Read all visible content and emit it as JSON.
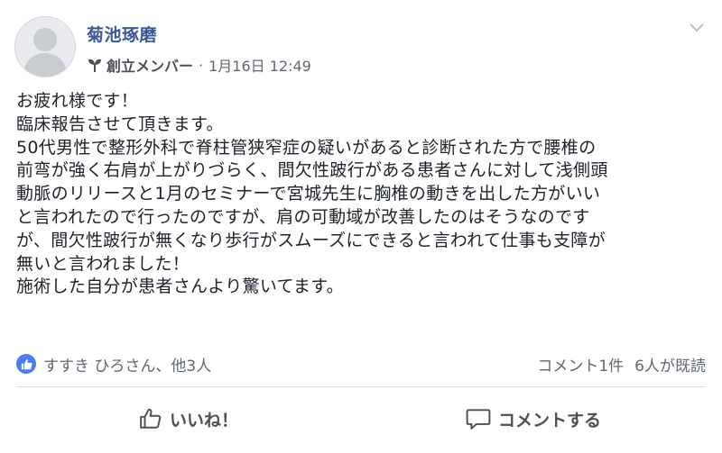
{
  "post": {
    "author": "菊池琢磨",
    "role": "創立メンバー",
    "separator": "·",
    "timestamp": "1月16日 12:49",
    "lines": [
      "お疲れ様です！",
      "臨床報告させて頂きます。",
      "50代男性で整形外科で脊柱管狭窄症の疑いがあると診断された方で腰椎の",
      "前弯が強く右肩が上がりづらく、間欠性跛行がある患者さんに対して浅側頭",
      "動脈のリリースと1月のセミナーで宮城先生に胸椎の動きを出した方がいい",
      "と言われたので行ったのですが、肩の可動域が改善したのはそうなのです",
      "が、間欠性跛行が無くなり歩行がスムーズにできると言われて仕事も支障が",
      "無いと言われました！",
      "施術した自分が患者さんより驚いてます。"
    ]
  },
  "summary": {
    "likes_text": "すすき ひろさん、他3人",
    "comments_text": "コメント1件",
    "seen_text": "6人が既読"
  },
  "actions": {
    "like_label": "いいね！",
    "comment_label": "コメントする"
  },
  "colors": {
    "author": "#3b5998",
    "like_badge": "#4a7cf6",
    "meta": "#616770"
  }
}
